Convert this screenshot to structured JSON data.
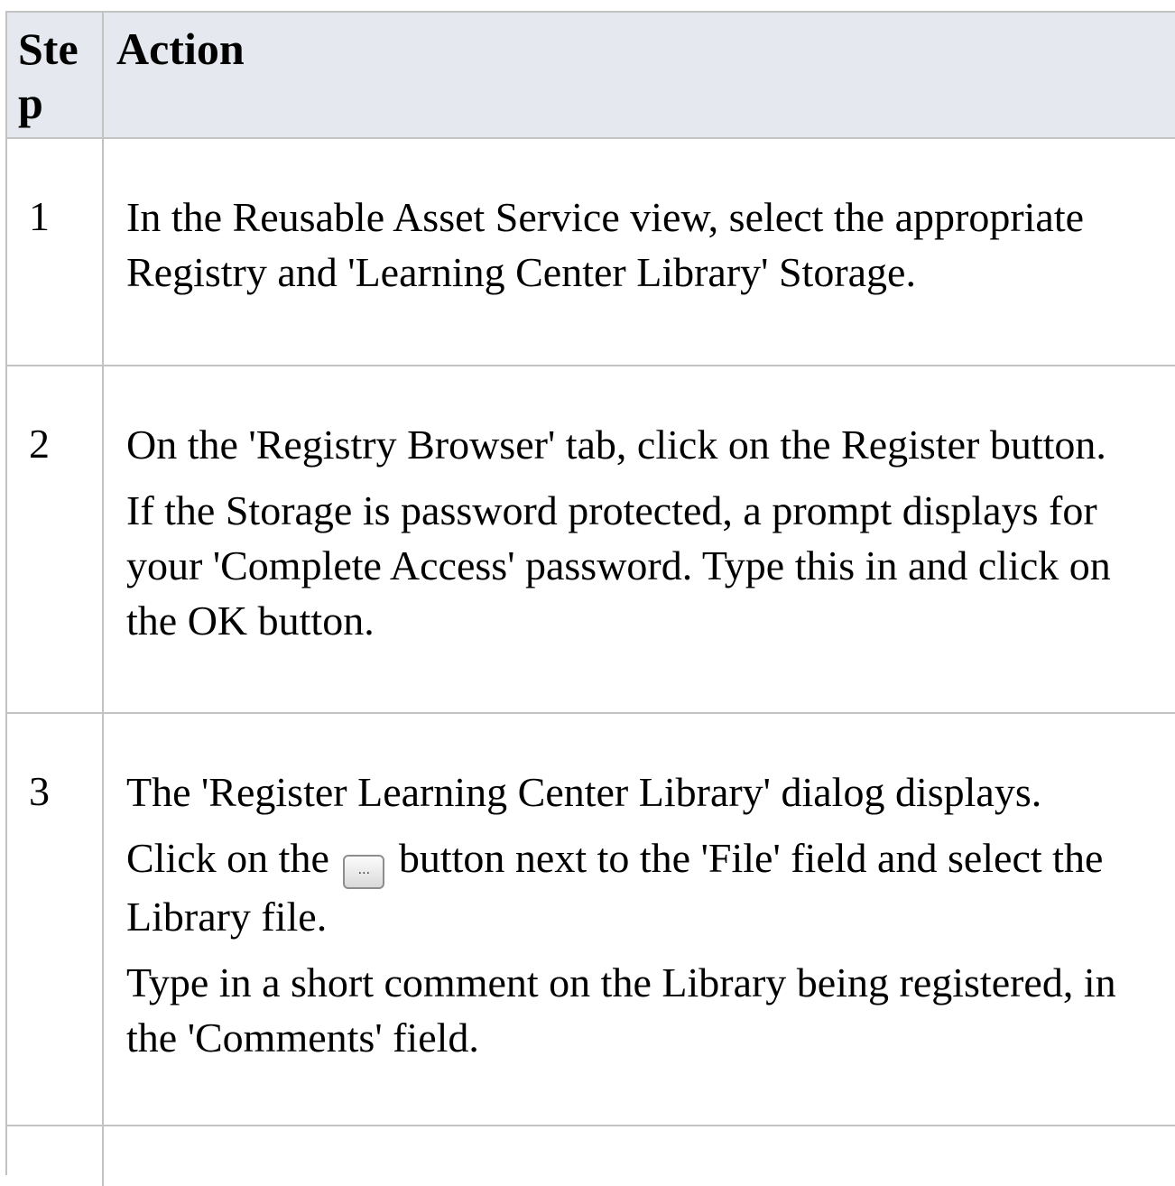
{
  "table": {
    "headers": {
      "step": "Step",
      "action": "Action"
    },
    "rows": [
      {
        "step": "1",
        "paragraphs": [
          "In the Reusable Asset Service view, select the appropriate Registry and 'Learning Center Library' Storage."
        ]
      },
      {
        "step": "2",
        "paragraphs": [
          "On the 'Registry Browser' tab, click on the Register button.",
          "If the Storage is password protected, a prompt displays for your 'Complete Access' password. Type this in and click on the OK button."
        ]
      },
      {
        "step": "3",
        "paragraphs": [
          "The 'Register Learning Center Library' dialog displays.",
          "Type in a short comment on the Library being registered, in the 'Comments' field."
        ],
        "browse_paragraph": {
          "before": "Click on the",
          "button_icon": "ellipsis-browse-button",
          "button_glyph": "...",
          "after": "button next to the 'File' field and select the Library file."
        }
      }
    ]
  }
}
